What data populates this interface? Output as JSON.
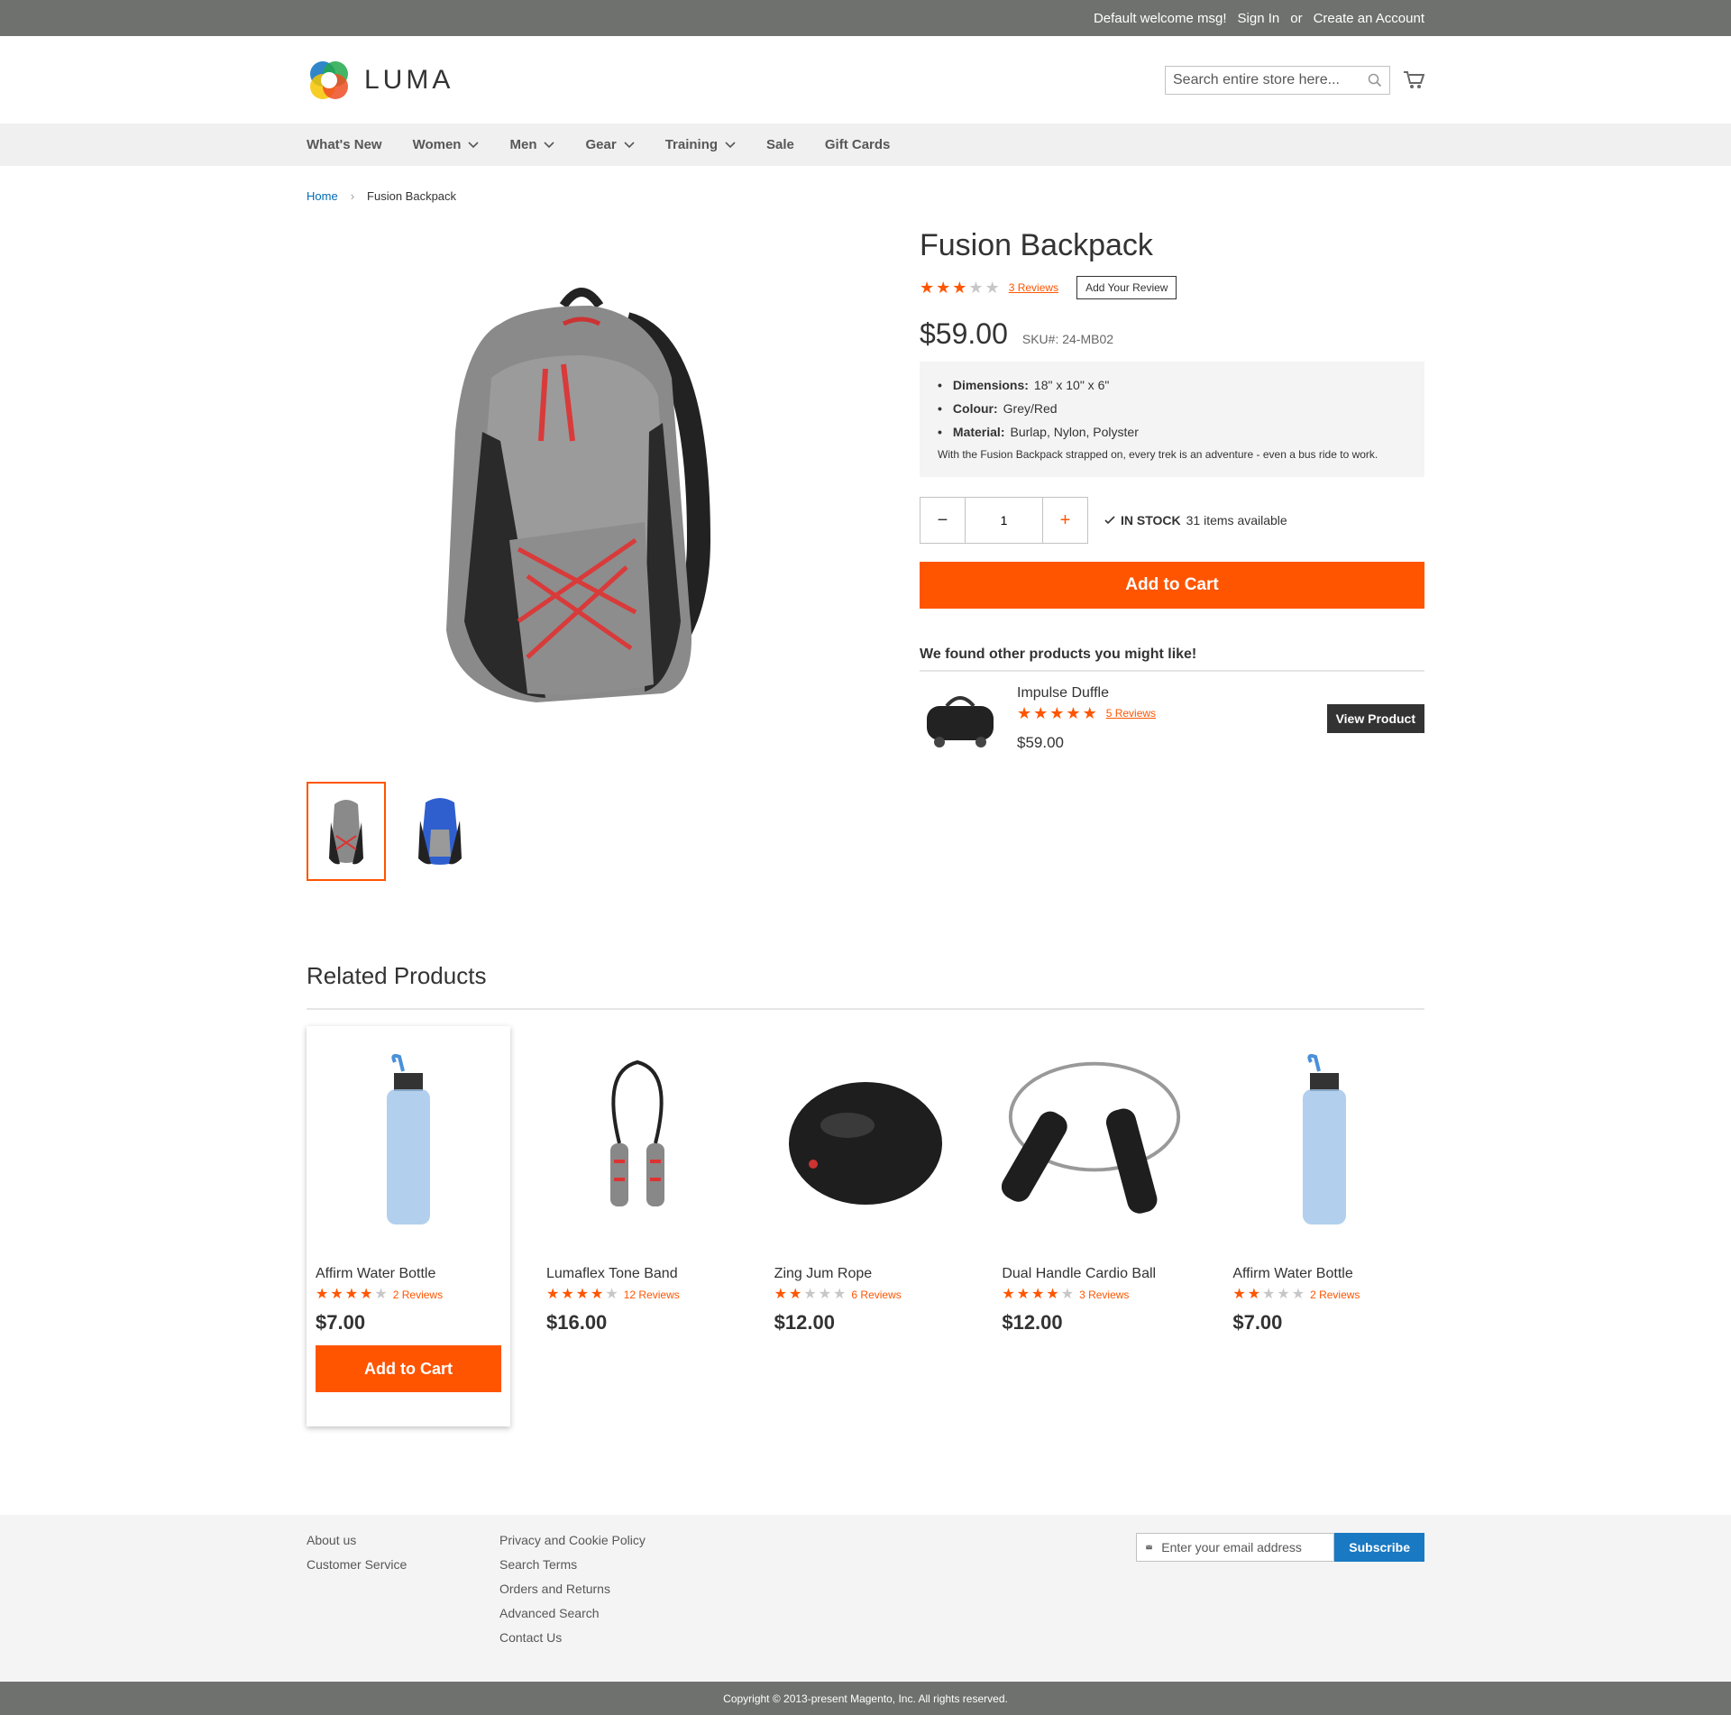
{
  "topbar": {
    "welcome": "Default welcome msg!",
    "sign_in": "Sign In",
    "or": "or",
    "create_account": "Create an Account"
  },
  "header": {
    "logo_text": "LUMA",
    "search_placeholder": "Search entire store here..."
  },
  "nav": {
    "items": [
      {
        "label": "What's New",
        "dropdown": false
      },
      {
        "label": "Women",
        "dropdown": true
      },
      {
        "label": "Men",
        "dropdown": true
      },
      {
        "label": "Gear",
        "dropdown": true
      },
      {
        "label": "Training",
        "dropdown": true
      },
      {
        "label": "Sale",
        "dropdown": false
      },
      {
        "label": "Gift Cards",
        "dropdown": false
      }
    ]
  },
  "breadcrumb": {
    "home": "Home",
    "separator": "›",
    "current": "Fusion Backpack"
  },
  "product": {
    "title": "Fusion Backpack",
    "rating": 3,
    "reviews": "3  Reviews",
    "add_review": "Add Your Review",
    "price": "$59.00",
    "sku": "SKU#: 24-MB02",
    "specs": [
      {
        "label": "Dimensions:",
        "value": "18\" x 10\" x 6\""
      },
      {
        "label": "Colour:",
        "value": "Grey/Red"
      },
      {
        "label": "Material:",
        "value": "Burlap, Nylon, Polyster"
      }
    ],
    "description": "With the Fusion Backpack strapped on, every trek is an adventure - even a bus ride to work.",
    "qty": "1",
    "stock_label": "IN STOCK",
    "stock_count": "31 items available",
    "add_to_cart": "Add to Cart"
  },
  "suggestion": {
    "heading": "We found other products you might like!",
    "name": "Impulse Duffle",
    "rating": 5,
    "reviews": "5  Reviews",
    "price": "$59.00",
    "button": "View Product"
  },
  "related": {
    "heading": "Related Products",
    "items": [
      {
        "name": "Affirm Water Bottle",
        "rating": 4,
        "reviews": "2  Reviews",
        "price": "$7.00",
        "add_to_cart": "Add to Cart"
      },
      {
        "name": "Lumaflex Tone Band",
        "rating": 4,
        "reviews": "12  Reviews",
        "price": "$16.00"
      },
      {
        "name": "Zing Jum Rope",
        "rating": 2,
        "reviews": "6  Reviews",
        "price": "$12.00"
      },
      {
        "name": "Dual Handle Cardio Ball",
        "rating": 4,
        "reviews": "3  Reviews",
        "price": "$12.00"
      },
      {
        "name": "Affirm Water Bottle",
        "rating": 2,
        "reviews": "2  Reviews",
        "price": "$7.00"
      }
    ]
  },
  "footer": {
    "col1": [
      "About us",
      "Customer Service"
    ],
    "col2": [
      "Privacy and Cookie Policy",
      "Search Terms",
      "Orders and Returns",
      "Advanced Search",
      "Contact Us"
    ],
    "newsletter_placeholder": "Enter your email address",
    "subscribe": "Subscribe",
    "copyright": "Copyright © 2013-present Magento, Inc. All rights reserved."
  },
  "colors": {
    "accent": "#ff5501",
    "link": "#006bb4",
    "subscribe": "#1979c3",
    "dark_strip": "#6e716e"
  }
}
